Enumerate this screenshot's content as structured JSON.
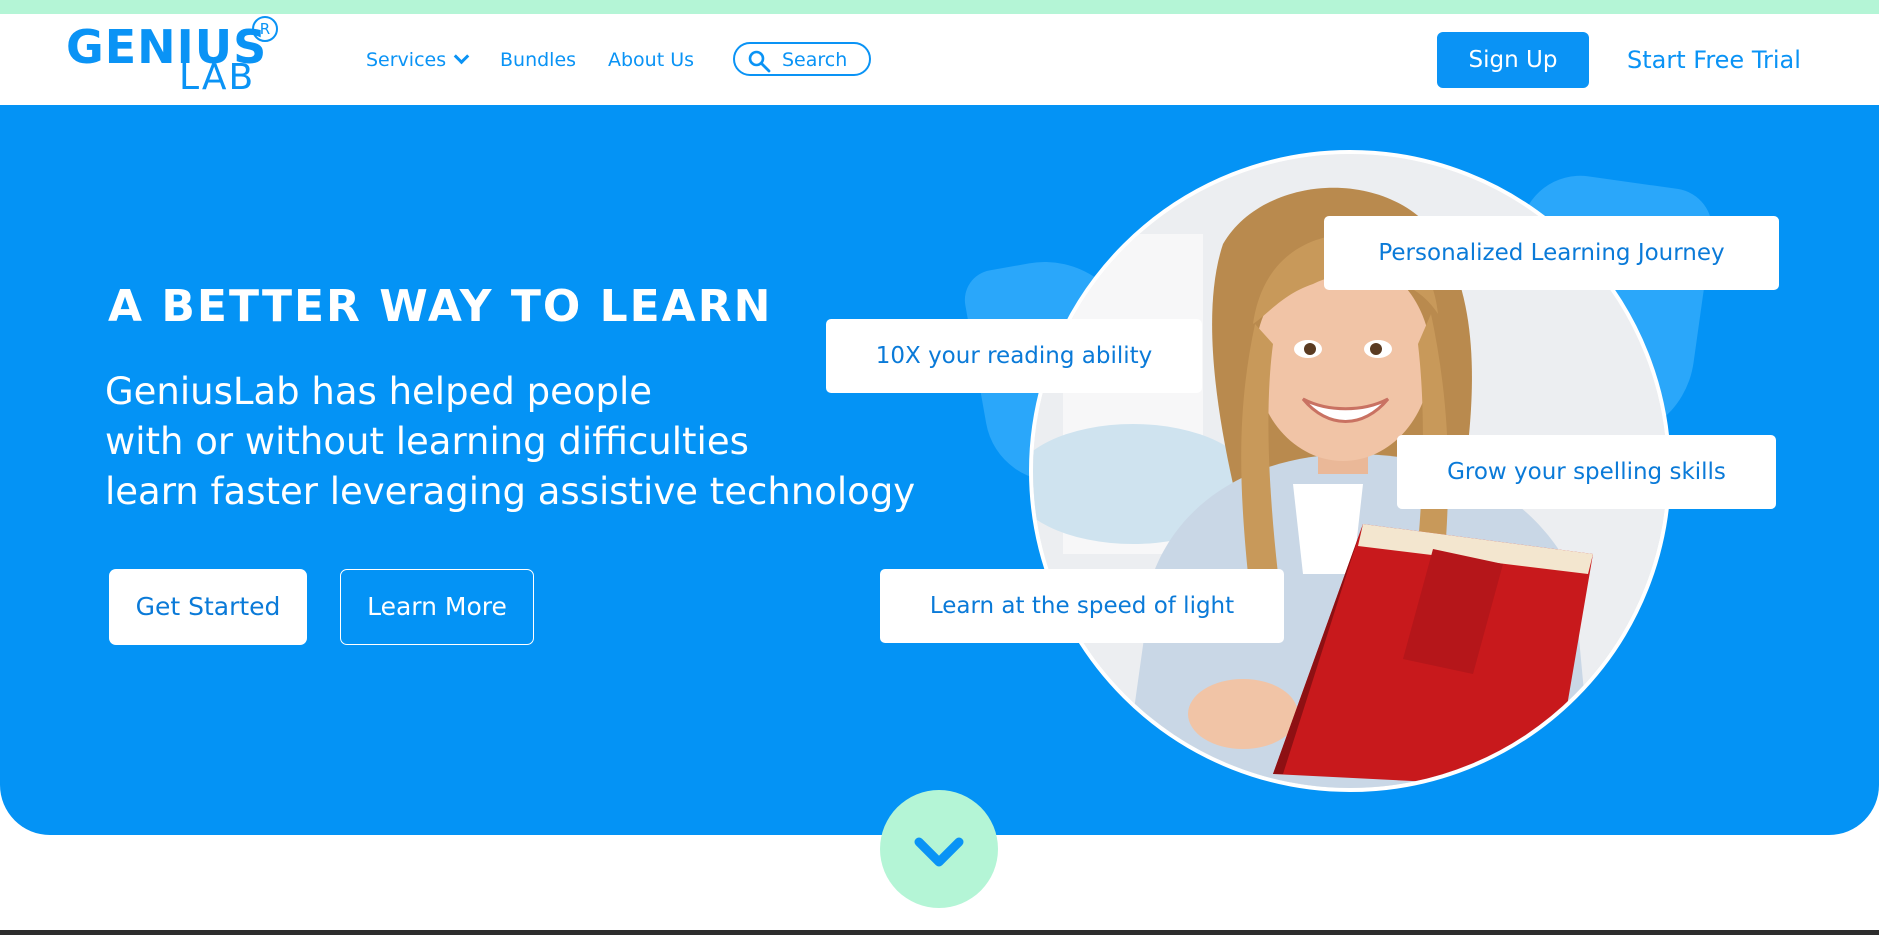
{
  "brand": {
    "name_top": "GENIUS",
    "name_bottom": "LAB",
    "registered_mark": "R"
  },
  "header": {
    "nav": [
      {
        "label": "Services",
        "has_dropdown": true
      },
      {
        "label": "Bundles"
      },
      {
        "label": "About Us"
      }
    ],
    "search": {
      "label": "Search",
      "icon": "search-icon"
    },
    "signup_label": "Sign Up",
    "trial_label": "Start Free Trial"
  },
  "hero": {
    "title": "A BETTER WAY TO LEARN",
    "description_lines": [
      "GeniusLab has helped people",
      "with or without learning difficulties",
      "learn faster leveraging assistive technology"
    ],
    "primary_button": "Get Started",
    "secondary_button": "Learn More",
    "feature_cards": [
      "Personalized Learning Journey",
      "10X your reading ability",
      "Grow your spelling skills",
      "Learn at the speed of light"
    ]
  },
  "scroll_icon": "chevron-down-icon",
  "colors": {
    "brand_blue": "#0493f5",
    "mint": "#b4f5d6",
    "white": "#ffffff"
  }
}
